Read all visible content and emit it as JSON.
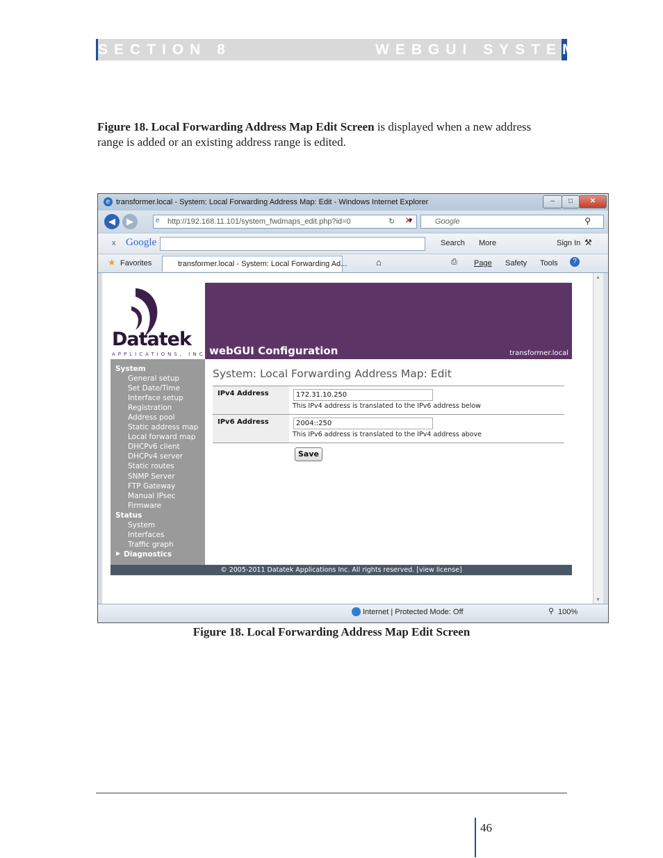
{
  "section_header": {
    "left": "SECTION 8",
    "right": "WEBGUI SYSTEM"
  },
  "intro": {
    "bold": "Figure 18. Local Forwarding Address Map Edit Screen",
    "rest": " is displayed when a new address range is added or an existing address range is edited."
  },
  "browser": {
    "window_title": "transformer.local - System: Local Forwarding Address Map: Edit - Windows Internet Explorer",
    "url": "http://192.168.11.101/system_fwdmaps_edit.php?id=0",
    "search_placeholder": "Google",
    "toolbar": {
      "google_logo": "Google",
      "search": "Search",
      "more": "More",
      "sign_in": "Sign In"
    },
    "favorites": "Favorites",
    "tab_title": "transformer.local - System: Local Forwarding Ad...",
    "cmd": {
      "page": "Page",
      "safety": "Safety",
      "tools": "Tools"
    },
    "status": {
      "zone": "Internet | Protected Mode: Off",
      "zoom": "100%"
    }
  },
  "webgui": {
    "logo_text": "Datatek",
    "logo_sub": "APPLICATIONS, INC",
    "banner_title": "webGUI Configuration",
    "hostname": "transformer.local",
    "menu": {
      "system_heading": "System",
      "system_items": [
        "General setup",
        "Set Date/Time",
        "Interface setup",
        "Registration",
        "Address pool",
        "Static address map",
        "Local forward map",
        "DHCPv6 client",
        "DHCPv4 server",
        "Static routes",
        "SNMP Server",
        "FTP Gateway",
        "Manual IPsec",
        "Firmware"
      ],
      "status_heading": "Status",
      "status_items": [
        "System",
        "Interfaces",
        "Traffic graph"
      ],
      "diagnostics": "Diagnostics"
    },
    "page_title": "System: Local Forwarding Address Map: Edit",
    "ipv4": {
      "label": "IPv4 Address",
      "value": "172.31.10.250",
      "help": "This IPv4 address is translated to the IPv6 address below"
    },
    "ipv6": {
      "label": "IPv6 Address",
      "value": "2004::250",
      "help": "This IPv6 address is translated to the IPv4 address above"
    },
    "save": "Save",
    "footer": "© 2005-2011 Datatek Applications Inc. All rights reserved.  [view license]"
  },
  "caption": "Figure 18. Local Forwarding Address Map Edit Screen",
  "page_number": "46",
  "colors": {
    "section_blue": "#1f4e9a",
    "banner_purple": "#5c3566",
    "menu_gray": "#9a9a9a"
  }
}
